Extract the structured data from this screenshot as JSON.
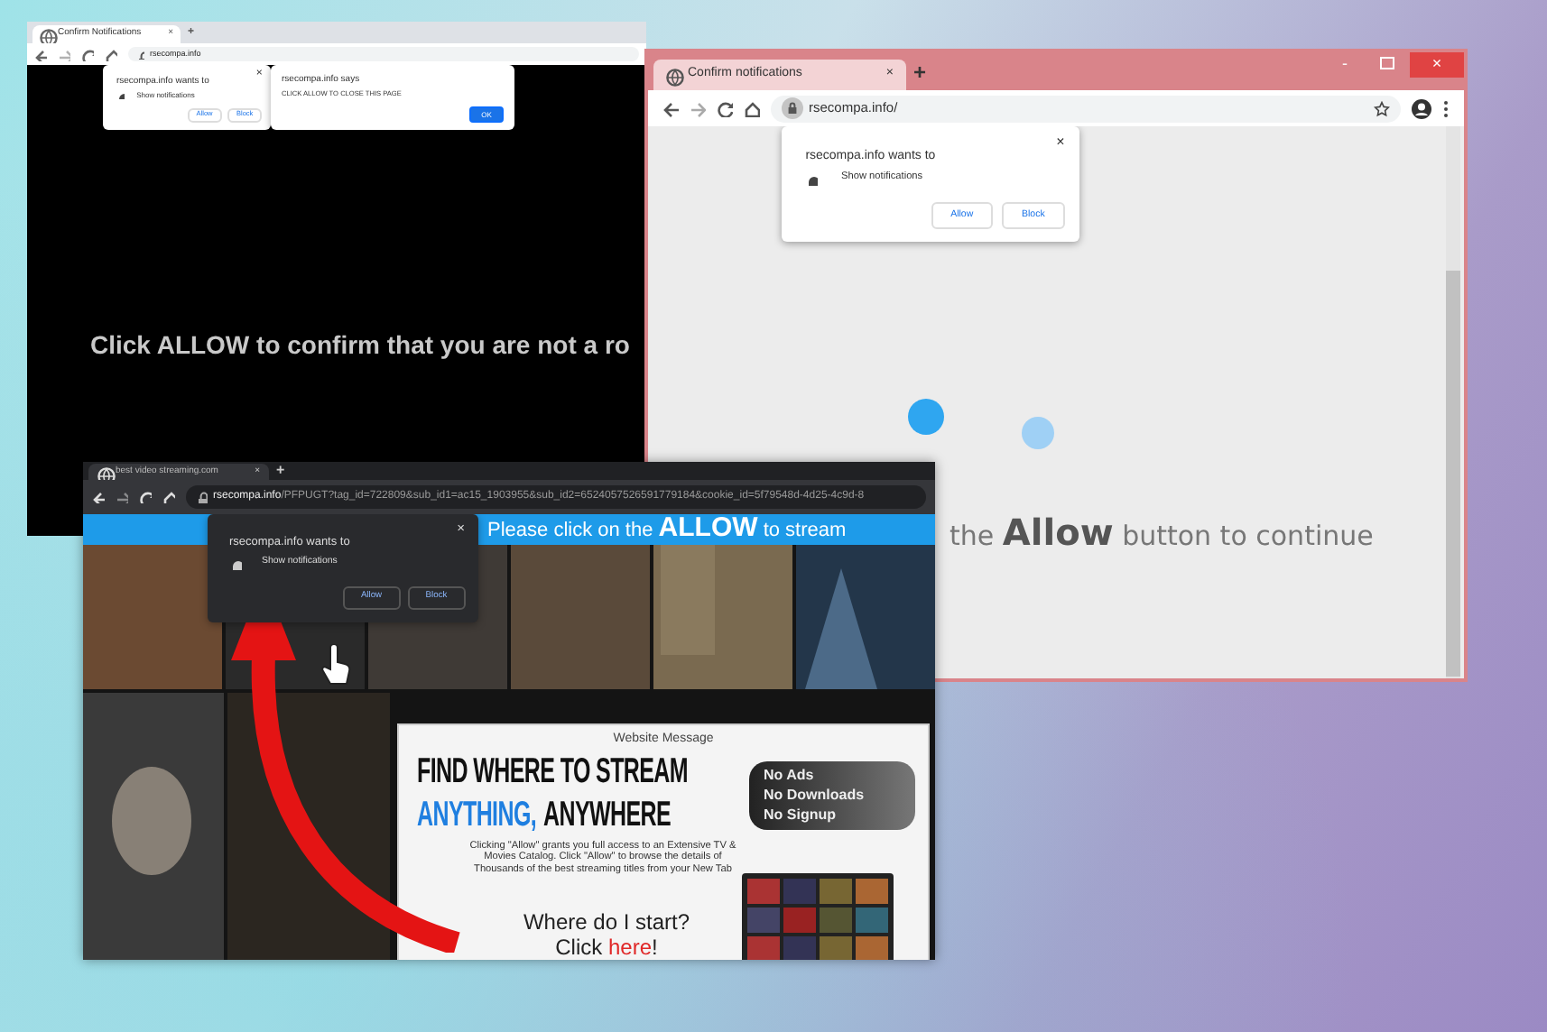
{
  "window_back": {
    "tab_title": "Confirm Notifications",
    "tab_close": "×",
    "new_tab": "+",
    "url": "rsecompa.info",
    "prompt": {
      "title": "rsecompa.info wants to",
      "close": "×",
      "item": "Show notifications",
      "buttons": [
        "Allow",
        "Block"
      ]
    },
    "alert": {
      "title": "rsecompa.info says",
      "message": "CLICK ALLOW TO CLOSE THIS PAGE",
      "button": "OK"
    },
    "headline": "Click ALLOW to confirm that you are not a ro"
  },
  "window_right": {
    "tab_title": "Confirm notifications",
    "tab_close": "×",
    "new_tab": "+",
    "minimize": "-",
    "close": "×",
    "url": "rsecompa.info/",
    "prompt": {
      "title": "rsecompa.info wants to",
      "close": "×",
      "item": "Show notifications",
      "buttons": [
        "Allow",
        "Block"
      ]
    },
    "message": "the **Allow** button to continue"
  },
  "window_front": {
    "tab_title": "best video streaming.com",
    "tab_close": "×",
    "new_tab": "+",
    "url_host": "rsecompa.info",
    "url_path": "/PFPUGT?tag_id=722809&sub_id1=ac15_1903955&sub_id2=6524057526591779184&cookie_id=5f79548d-4d25-4c9d-8",
    "banner": "Please click on the **ALLOW** to stream",
    "prompt": {
      "title": "rsecompa.info wants to",
      "close": "×",
      "item": "Show notifications",
      "buttons": [
        "Allow",
        "Block"
      ]
    },
    "dialog": {
      "title": "Website Message",
      "heading_1": "FIND WHERE TO STREAM",
      "heading_2_accent": "ANYTHING,",
      "heading_2_rest": "ANYWHERE",
      "perks": [
        "No Ads",
        "No Downloads",
        "No Signup"
      ],
      "body": "Clicking \"Allow\" grants you full access to an Extensive TV & Movies Catalog. Click \"Allow\" to browse the details of Thousands of the best streaming titles from your New Tab",
      "question": "Where do I start?",
      "cta_prefix": "Click",
      "cta_link": "here",
      "cta_suffix": "!"
    }
  }
}
